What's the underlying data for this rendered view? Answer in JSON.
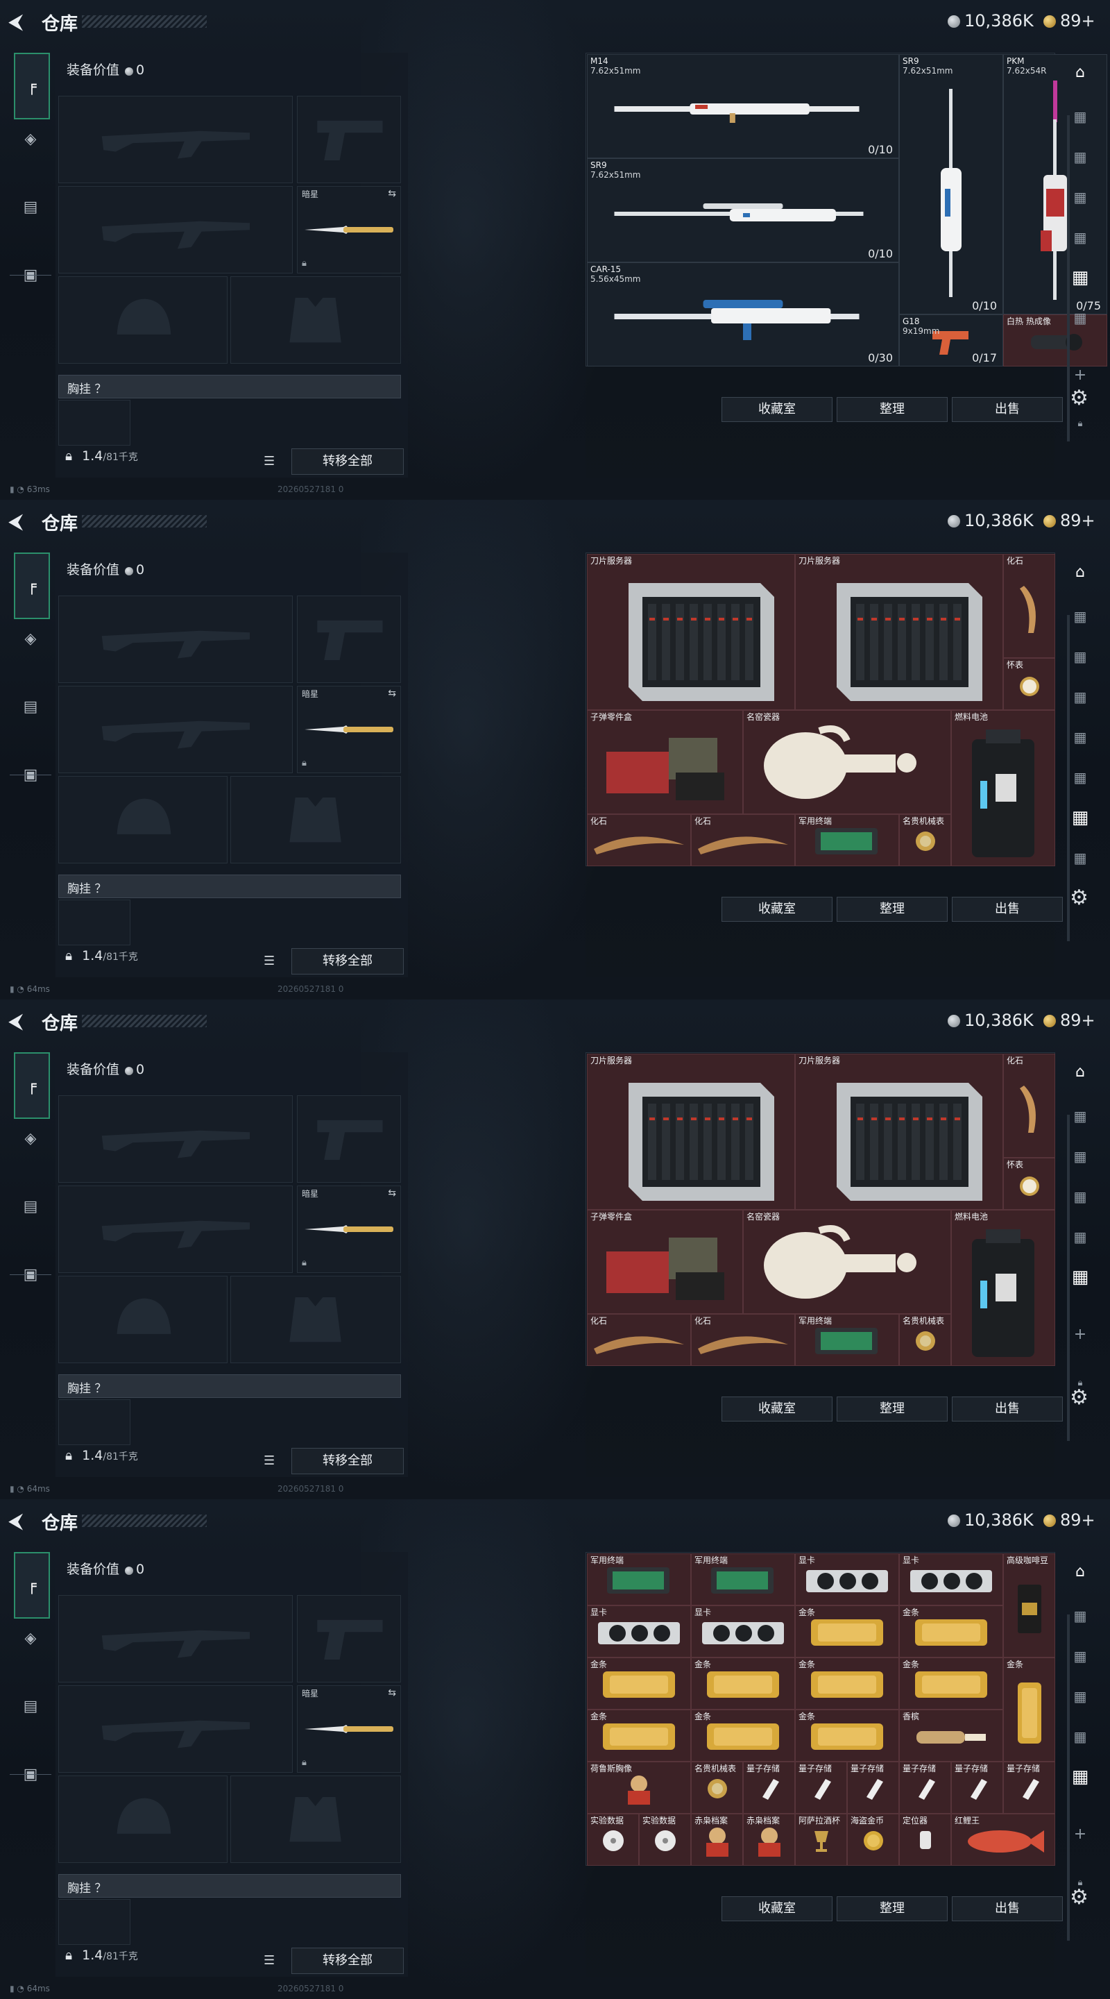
{
  "app": {
    "title": "仓库",
    "silver": "10,386K",
    "gold": "89+",
    "equip_value_label": "装备价值",
    "equip_value": "0",
    "sidearm_slot_label": "暗星",
    "rig_label": "胸挂 ？",
    "weight": "1.4",
    "weight_max": "/81千克",
    "transfer_label": "转移全部",
    "collect_label": "收藏室",
    "sort_label": "整理",
    "sell_label": "出售",
    "build": "20260527181 0"
  },
  "panels": [
    {
      "ping": "63ms",
      "tab_count": 6,
      "active_tab": 4,
      "items": [
        {
          "name": "M14",
          "sub": "7.62x51mm",
          "count": "0/10",
          "color": "gray",
          "art": "rifle",
          "x": 0,
          "y": 0,
          "w": 3,
          "h": 1
        },
        {
          "name": "SR9",
          "sub": "7.62x51mm",
          "count": "0/10",
          "color": "gray",
          "art": "sniper",
          "x": 0,
          "y": 1,
          "w": 3,
          "h": 1
        },
        {
          "name": "CAR-15",
          "sub": "5.56x45mm",
          "count": "0/30",
          "color": "gray",
          "art": "carbine",
          "x": 0,
          "y": 2,
          "w": 3,
          "h": 1
        },
        {
          "name": "SR9",
          "sub": "7.62x51mm",
          "count": "0/10",
          "color": "gray",
          "art": "sniper-v",
          "x": 3,
          "y": 0,
          "w": 1,
          "h": 2.5
        },
        {
          "name": "PKM",
          "sub": "7.62x54R",
          "count": "0/75",
          "color": "gray",
          "art": "mg-v",
          "x": 4,
          "y": 0,
          "w": 1,
          "h": 2.5
        },
        {
          "name": "G18",
          "sub": "9x19mm",
          "count": "0/17",
          "color": "gray",
          "art": "pistol",
          "x": 3,
          "y": 2.5,
          "w": 1,
          "h": 0.5
        },
        {
          "name": "白热 热成像",
          "sub": "",
          "count": "",
          "color": "red",
          "art": "scope",
          "x": 4,
          "y": 2.5,
          "w": 1,
          "h": 0.5
        }
      ]
    },
    {
      "ping": "64ms",
      "tab_count": 7,
      "active_tab": 5,
      "items": [
        {
          "name": "刀片服务器",
          "color": "red",
          "art": "server",
          "x": 0,
          "y": 0,
          "w": 2,
          "h": 1.5
        },
        {
          "name": "刀片服务器",
          "color": "red",
          "art": "server",
          "x": 2,
          "y": 0,
          "w": 2,
          "h": 1.5
        },
        {
          "name": "化石",
          "color": "red",
          "art": "claw",
          "x": 4,
          "y": 0,
          "w": 0.5,
          "h": 1
        },
        {
          "name": "怀表",
          "color": "red",
          "art": "watch",
          "x": 4,
          "y": 1,
          "w": 0.5,
          "h": 0.5
        },
        {
          "name": "子弹零件盒",
          "color": "red",
          "art": "ammo",
          "x": 0,
          "y": 1.5,
          "w": 1.5,
          "h": 1
        },
        {
          "name": "名窑瓷器",
          "color": "red",
          "art": "vase",
          "x": 1.5,
          "y": 1.5,
          "w": 2,
          "h": 1
        },
        {
          "name": "燃料电池",
          "color": "red",
          "art": "battery",
          "x": 3.5,
          "y": 1.5,
          "w": 1,
          "h": 1.5
        },
        {
          "name": "化石",
          "color": "red",
          "art": "fossil",
          "x": 0,
          "y": 2.5,
          "w": 1,
          "h": 0.5
        },
        {
          "name": "化石",
          "color": "red",
          "art": "fossil",
          "x": 1,
          "y": 2.5,
          "w": 1,
          "h": 0.5
        },
        {
          "name": "军用终端",
          "color": "red",
          "art": "board",
          "x": 2,
          "y": 2.5,
          "w": 1,
          "h": 0.5
        },
        {
          "name": "名贵机械表",
          "color": "red",
          "art": "rolex",
          "x": 3,
          "y": 2.5,
          "w": 0.5,
          "h": 0.5
        }
      ]
    },
    {
      "ping": "64ms",
      "tab_count": 5,
      "active_tab": 4,
      "items": [
        {
          "name": "刀片服务器",
          "color": "red",
          "art": "server",
          "x": 0,
          "y": 0,
          "w": 2,
          "h": 1.5
        },
        {
          "name": "刀片服务器",
          "color": "red",
          "art": "server",
          "x": 2,
          "y": 0,
          "w": 2,
          "h": 1.5
        },
        {
          "name": "化石",
          "color": "red",
          "art": "claw",
          "x": 4,
          "y": 0,
          "w": 0.5,
          "h": 1
        },
        {
          "name": "怀表",
          "color": "red",
          "art": "watch",
          "x": 4,
          "y": 1,
          "w": 0.5,
          "h": 0.5
        },
        {
          "name": "子弹零件盒",
          "color": "red",
          "art": "ammo",
          "x": 0,
          "y": 1.5,
          "w": 1.5,
          "h": 1
        },
        {
          "name": "名窑瓷器",
          "color": "red",
          "art": "vase",
          "x": 1.5,
          "y": 1.5,
          "w": 2,
          "h": 1
        },
        {
          "name": "燃料电池",
          "color": "red",
          "art": "battery",
          "x": 3.5,
          "y": 1.5,
          "w": 1,
          "h": 1.5
        },
        {
          "name": "化石",
          "color": "red",
          "art": "fossil",
          "x": 0,
          "y": 2.5,
          "w": 1,
          "h": 0.5
        },
        {
          "name": "化石",
          "color": "red",
          "art": "fossil",
          "x": 1,
          "y": 2.5,
          "w": 1,
          "h": 0.5
        },
        {
          "name": "军用终端",
          "color": "red",
          "art": "board",
          "x": 2,
          "y": 2.5,
          "w": 1,
          "h": 0.5
        },
        {
          "name": "名贵机械表",
          "color": "red",
          "art": "rolex",
          "x": 3,
          "y": 2.5,
          "w": 0.5,
          "h": 0.5
        }
      ]
    },
    {
      "ping": "64ms",
      "tab_count": 5,
      "active_tab": 4,
      "items": [
        {
          "name": "军用终端",
          "color": "red",
          "art": "board",
          "x": 0,
          "y": 0,
          "w": 1,
          "h": 0.5
        },
        {
          "name": "军用终端",
          "color": "red",
          "art": "board",
          "x": 1,
          "y": 0,
          "w": 1,
          "h": 0.5
        },
        {
          "name": "显卡",
          "color": "red",
          "art": "gpu",
          "x": 2,
          "y": 0,
          "w": 1,
          "h": 0.5
        },
        {
          "name": "显卡",
          "color": "red",
          "art": "gpu",
          "x": 3,
          "y": 0,
          "w": 1,
          "h": 0.5
        },
        {
          "name": "高级咖啡豆",
          "color": "red",
          "art": "coffee",
          "x": 4,
          "y": 0,
          "w": 0.5,
          "h": 1
        },
        {
          "name": "显卡",
          "color": "red",
          "art": "gpu",
          "x": 0,
          "y": 0.5,
          "w": 1,
          "h": 0.5
        },
        {
          "name": "显卡",
          "color": "red",
          "art": "gpu",
          "x": 1,
          "y": 0.5,
          "w": 1,
          "h": 0.5
        },
        {
          "name": "金条",
          "color": "red",
          "art": "gold",
          "x": 2,
          "y": 0.5,
          "w": 1,
          "h": 0.5
        },
        {
          "name": "金条",
          "color": "red",
          "art": "gold",
          "x": 3,
          "y": 0.5,
          "w": 1,
          "h": 0.5
        },
        {
          "name": "金条",
          "color": "red",
          "art": "gold",
          "x": 0,
          "y": 1,
          "w": 1,
          "h": 0.5
        },
        {
          "name": "金条",
          "color": "red",
          "art": "gold",
          "x": 1,
          "y": 1,
          "w": 1,
          "h": 0.5
        },
        {
          "name": "金条",
          "color": "red",
          "art": "gold",
          "x": 2,
          "y": 1,
          "w": 1,
          "h": 0.5
        },
        {
          "name": "金条",
          "color": "red",
          "art": "gold",
          "x": 3,
          "y": 1,
          "w": 1,
          "h": 0.5
        },
        {
          "name": "金条",
          "color": "red",
          "art": "goldv",
          "x": 4,
          "y": 1,
          "w": 0.5,
          "h": 1
        },
        {
          "name": "金条",
          "color": "red",
          "art": "gold",
          "x": 0,
          "y": 1.5,
          "w": 1,
          "h": 0.5
        },
        {
          "name": "金条",
          "color": "red",
          "art": "gold",
          "x": 1,
          "y": 1.5,
          "w": 1,
          "h": 0.5
        },
        {
          "name": "金条",
          "color": "red",
          "art": "gold",
          "x": 2,
          "y": 1.5,
          "w": 1,
          "h": 0.5
        },
        {
          "name": "香槟",
          "color": "red",
          "art": "bottle",
          "x": 3,
          "y": 1.5,
          "w": 1,
          "h": 0.5
        },
        {
          "name": "荷鲁斯胸像",
          "color": "red",
          "art": "bust",
          "x": 0,
          "y": 2,
          "w": 1,
          "h": 0.5
        },
        {
          "name": "名贵机械表",
          "color": "red",
          "art": "rolex",
          "x": 1,
          "y": 2,
          "w": 0.5,
          "h": 0.5
        },
        {
          "name": "量子存储",
          "color": "red",
          "art": "usb",
          "x": 1.5,
          "y": 2,
          "w": 0.5,
          "h": 0.5
        },
        {
          "name": "量子存储",
          "color": "red",
          "art": "usb",
          "x": 2,
          "y": 2,
          "w": 0.5,
          "h": 0.5
        },
        {
          "name": "量子存储",
          "color": "red",
          "art": "usb",
          "x": 2.5,
          "y": 2,
          "w": 0.5,
          "h": 0.5
        },
        {
          "name": "量子存储",
          "color": "red",
          "art": "usb",
          "x": 3,
          "y": 2,
          "w": 0.5,
          "h": 0.5
        },
        {
          "name": "量子存储",
          "color": "red",
          "art": "usb",
          "x": 3.5,
          "y": 2,
          "w": 0.5,
          "h": 0.5
        },
        {
          "name": "量子存储",
          "color": "red",
          "art": "usb",
          "x": 4,
          "y": 2,
          "w": 0.5,
          "h": 0.5
        },
        {
          "name": "实验数据",
          "color": "red",
          "art": "disc",
          "x": 0,
          "y": 2.5,
          "w": 0.5,
          "h": 0.5
        },
        {
          "name": "实验数据",
          "color": "red",
          "art": "disc",
          "x": 0.5,
          "y": 2.5,
          "w": 0.5,
          "h": 0.5
        },
        {
          "name": "赤枭档案",
          "color": "red",
          "art": "bust",
          "x": 1,
          "y": 2.5,
          "w": 0.5,
          "h": 0.5
        },
        {
          "name": "赤枭档案",
          "color": "red",
          "art": "bust",
          "x": 1.5,
          "y": 2.5,
          "w": 0.5,
          "h": 0.5
        },
        {
          "name": "阿萨拉酒杯",
          "color": "red",
          "art": "cup",
          "x": 2,
          "y": 2.5,
          "w": 0.5,
          "h": 0.5
        },
        {
          "name": "海盗金币",
          "color": "red",
          "art": "coin",
          "x": 2.5,
          "y": 2.5,
          "w": 0.5,
          "h": 0.5
        },
        {
          "name": "定位器",
          "color": "red",
          "art": "tag",
          "x": 3,
          "y": 2.5,
          "w": 0.5,
          "h": 0.5
        },
        {
          "name": "红鲤王",
          "color": "red",
          "art": "fish",
          "x": 3.5,
          "y": 2.5,
          "w": 1,
          "h": 0.5
        }
      ]
    }
  ]
}
